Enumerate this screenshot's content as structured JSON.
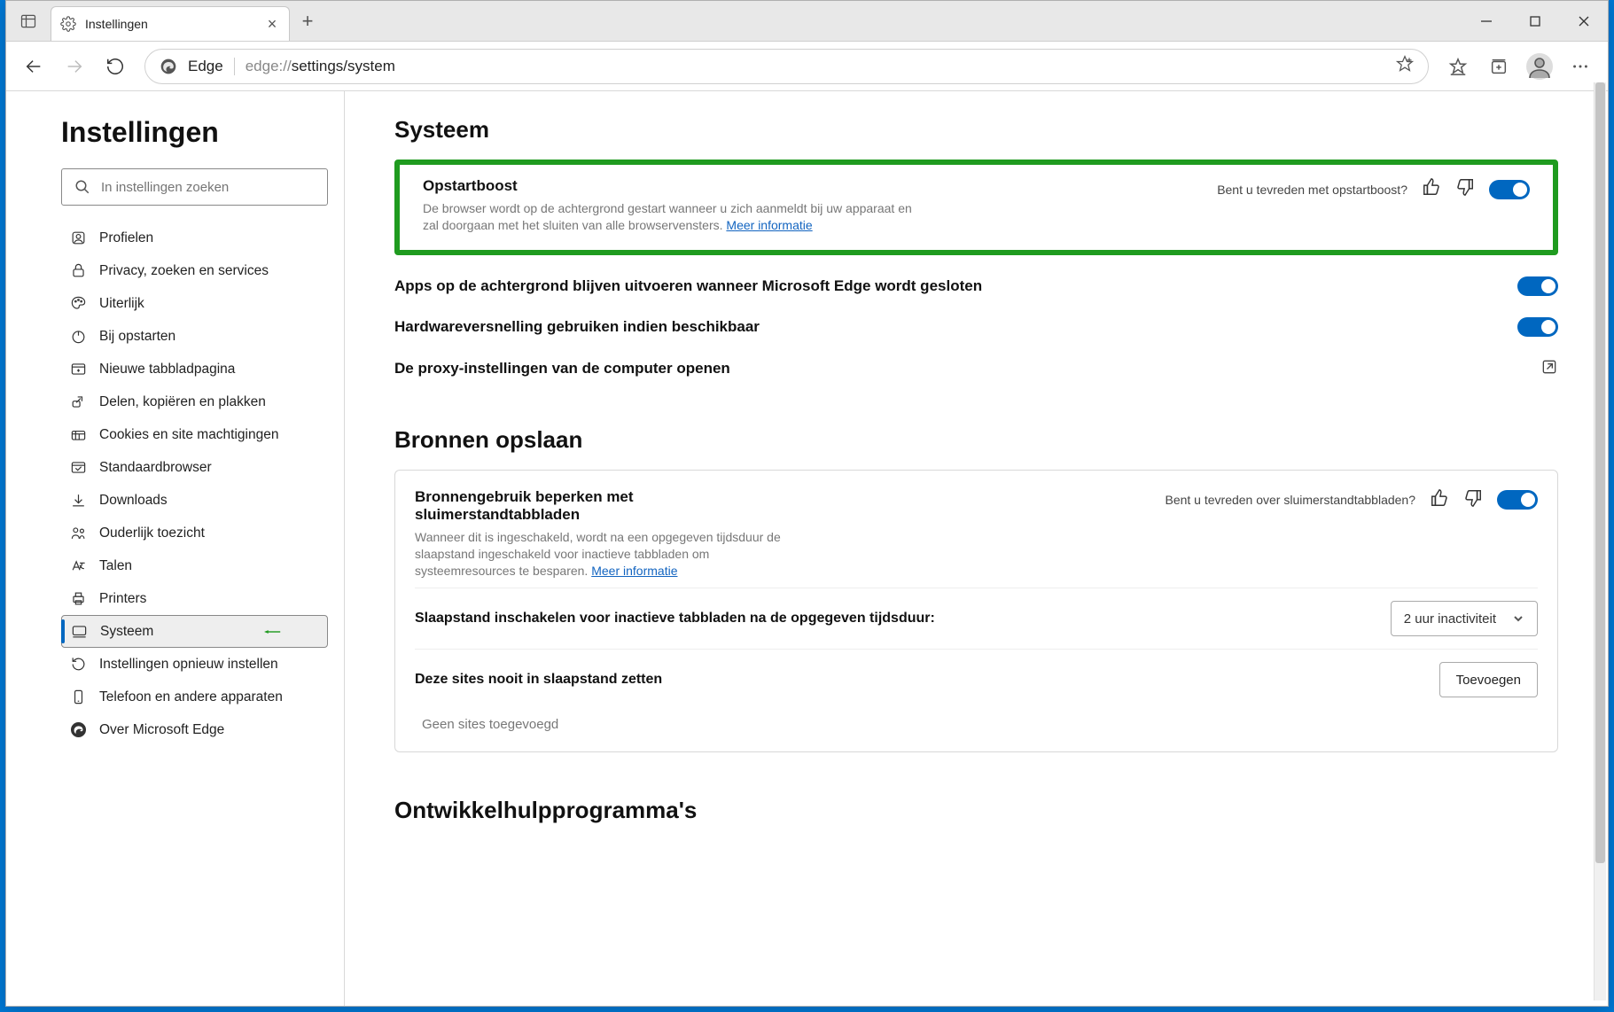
{
  "window": {
    "tab_title": "Instellingen"
  },
  "toolbar": {
    "addr_label": "Edge",
    "addr_prefix": "edge://",
    "addr_path": "settings/system"
  },
  "sidebar": {
    "title": "Instellingen",
    "search_placeholder": "In instellingen zoeken",
    "items": [
      {
        "label": "Profielen"
      },
      {
        "label": "Privacy, zoeken en services"
      },
      {
        "label": "Uiterlijk"
      },
      {
        "label": "Bij opstarten"
      },
      {
        "label": "Nieuwe tabbladpagina"
      },
      {
        "label": "Delen, kopiëren en plakken"
      },
      {
        "label": "Cookies en site machtigingen"
      },
      {
        "label": "Standaardbrowser"
      },
      {
        "label": "Downloads"
      },
      {
        "label": "Ouderlijk toezicht"
      },
      {
        "label": "Talen"
      },
      {
        "label": "Printers"
      },
      {
        "label": "Systeem"
      },
      {
        "label": "Instellingen opnieuw instellen"
      },
      {
        "label": "Telefoon en andere apparaten"
      },
      {
        "label": "Over Microsoft Edge"
      }
    ]
  },
  "main": {
    "heading": "Systeem",
    "startup_boost": {
      "title": "Opstartboost",
      "desc": "De browser wordt op de achtergrond gestart wanneer u zich aanmeldt bij uw apparaat en zal doorgaan met het sluiten van alle browservensters. ",
      "link": "Meer informatie",
      "feedback_q": "Bent u tevreden met opstartboost?"
    },
    "bg_apps": "Apps op de achtergrond blijven uitvoeren wanneer Microsoft Edge wordt gesloten",
    "hw_accel": "Hardwareversnelling gebruiken indien beschikbaar",
    "proxy": "De proxy-instellingen van de computer openen",
    "resources": {
      "heading": "Bronnen opslaan",
      "sleep_tabs": {
        "title": "Bronnengebruik beperken met sluimerstandtabbladen",
        "desc": "Wanneer dit is ingeschakeld, wordt na een opgegeven tijdsduur de slaapstand ingeschakeld voor inactieve tabbladen om systeemresources te besparen. ",
        "link": "Meer informatie",
        "feedback_q": "Bent u tevreden over sluimerstandtabbladen?"
      },
      "inactive_label": "Slaapstand inschakelen voor inactieve tabbladen na de opgegeven tijdsduur:",
      "inactive_value": "2 uur inactiviteit",
      "never_sleep_label": "Deze sites nooit in slaapstand zetten",
      "add_button": "Toevoegen",
      "empty": "Geen sites toegevoegd"
    },
    "devtools_heading": "Ontwikkelhulpprogramma's"
  }
}
